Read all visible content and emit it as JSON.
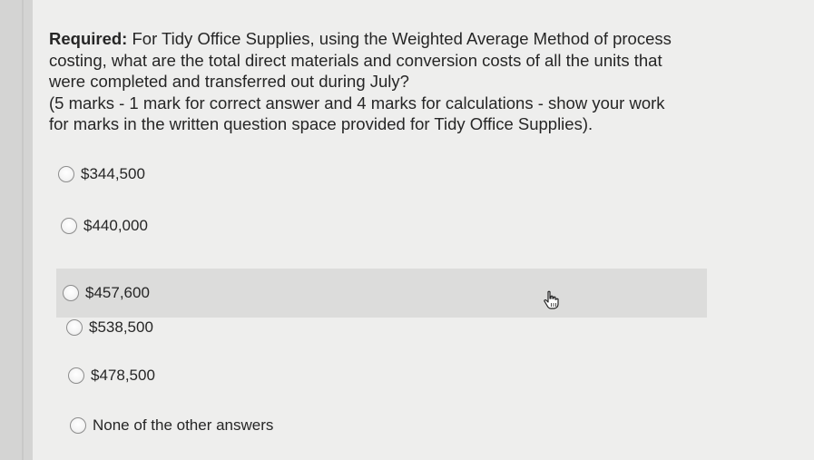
{
  "question": {
    "required_label": "Required:",
    "line1": " For Tidy Office Supplies, using the Weighted Average Method of process",
    "line2": "costing, what are the total direct materials and conversion costs of all the units that",
    "line3": "were completed and transferred out during July?",
    "line4": "(5 marks - 1 mark for correct answer and 4 marks for calculations - show your work",
    "line5": "for marks in the written question space provided for Tidy Office Supplies)."
  },
  "options": [
    {
      "label": "$344,500"
    },
    {
      "label": "$440,000"
    },
    {
      "label": "$457,600"
    },
    {
      "label": "$538,500"
    },
    {
      "label": "$478,500"
    },
    {
      "label": "None of the other answers"
    }
  ],
  "hovered_option": "$457,600",
  "cursor": "hand-pointer-icon"
}
